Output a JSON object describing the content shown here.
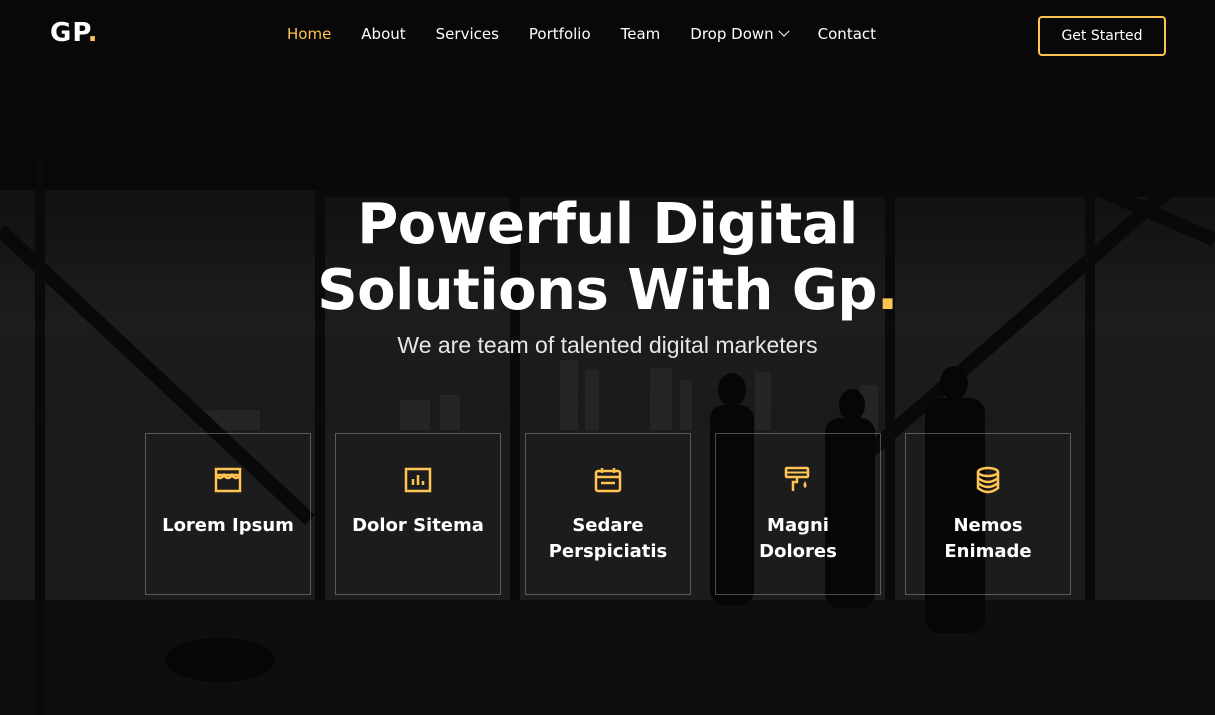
{
  "brand": {
    "logo_text": "GP",
    "logo_dot": "."
  },
  "nav": {
    "items": [
      "Home",
      "About",
      "Services",
      "Portfolio",
      "Team",
      "Drop Down",
      "Contact"
    ],
    "active": "Home"
  },
  "cta": {
    "label": "Get Started"
  },
  "hero": {
    "title_line1": "Powerful Digital",
    "title_line2": "Solutions With Gp",
    "title_dot": ".",
    "subtitle": "We are team of talented digital marketers"
  },
  "features": [
    {
      "icon": "store-icon",
      "label": "Lorem Ipsum"
    },
    {
      "icon": "bar-chart-icon",
      "label": "Dolor Sitema"
    },
    {
      "icon": "calendar-icon",
      "label": "Sedare Perspiciatis"
    },
    {
      "icon": "paint-roller-icon",
      "label": "Magni Dolores"
    },
    {
      "icon": "database-icon",
      "label": "Nemos Enimade"
    }
  ],
  "colors": {
    "accent": "#ffc451",
    "text": "#ffffff"
  }
}
